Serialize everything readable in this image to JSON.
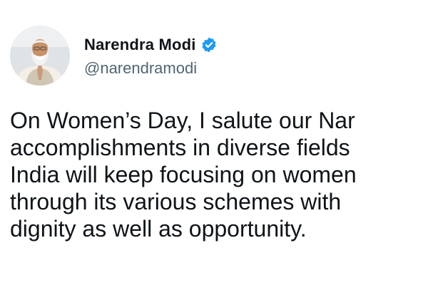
{
  "author": {
    "display_name": "Narendra Modi",
    "handle": "@narendramodi",
    "verified": true,
    "avatar_icon": "profile-photo",
    "verified_icon": "verified-badge-icon",
    "verified_color": "#1d9bf0"
  },
  "tweet": {
    "lines": [
      "On Women’s Day, I salute our Nar",
      "accomplishments in diverse fields",
      "India will keep focusing on women",
      "through its various schemes with",
      "dignity as well as opportunity."
    ]
  },
  "colors": {
    "text": "#0f1419",
    "secondary": "#536471",
    "background": "#ffffff"
  }
}
